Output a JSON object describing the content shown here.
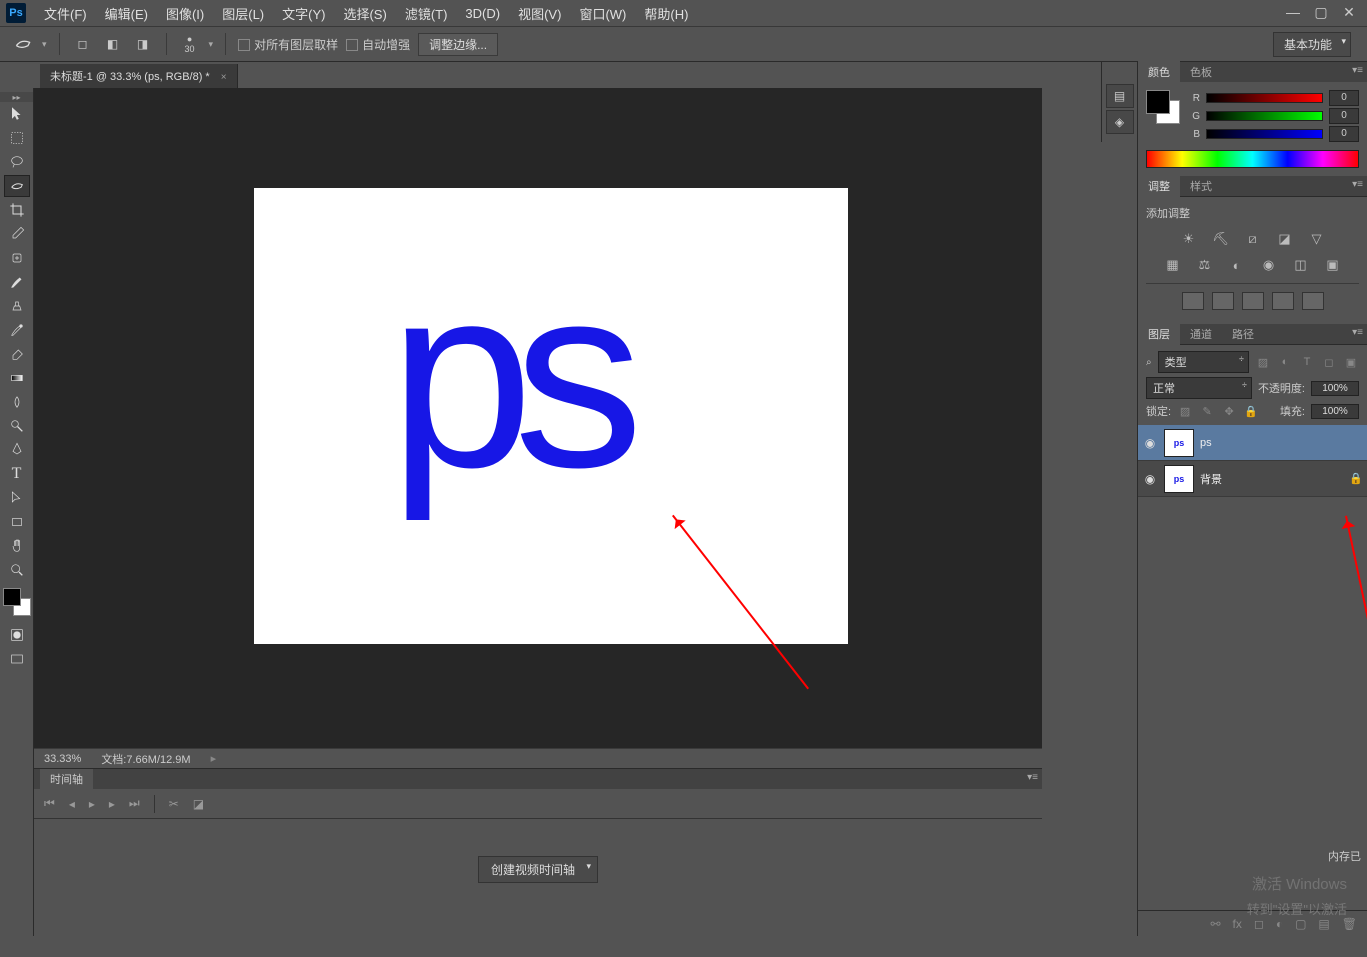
{
  "app": {
    "logo": "Ps"
  },
  "menu": [
    "文件(F)",
    "编辑(E)",
    "图像(I)",
    "图层(L)",
    "文字(Y)",
    "选择(S)",
    "滤镜(T)",
    "3D(D)",
    "视图(V)",
    "窗口(W)",
    "帮助(H)"
  ],
  "options": {
    "brush_size": "30",
    "sample_all": "对所有图层取样",
    "auto_enhance": "自动增强",
    "refine_edge": "调整边缘..."
  },
  "workspace": "基本功能",
  "doc_tab": "未标题-1 @ 33.3% (ps, RGB/8) *",
  "canvas_text": "ps",
  "status": {
    "zoom": "33.33%",
    "doc_info": "文档:7.66M/12.9M"
  },
  "timeline": {
    "tab": "时间轴",
    "create_btn": "创建视频时间轴"
  },
  "color": {
    "tabs": [
      "颜色",
      "色板"
    ],
    "r_label": "R",
    "g_label": "G",
    "b_label": "B",
    "r": "0",
    "g": "0",
    "b": "0"
  },
  "adjustments": {
    "tabs": [
      "调整",
      "样式"
    ],
    "title": "添加调整"
  },
  "layers": {
    "tabs": [
      "图层",
      "通道",
      "路径"
    ],
    "filter_label": "类型",
    "blend_mode": "正常",
    "opacity_label": "不透明度:",
    "opacity": "100%",
    "lock_label": "锁定:",
    "fill_label": "填充:",
    "fill": "100%",
    "items": [
      {
        "name": "ps",
        "thumb_text": "ps",
        "selected": true,
        "locked": false
      },
      {
        "name": "背景",
        "thumb_text": "ps",
        "selected": false,
        "locked": true
      }
    ]
  },
  "unsaved_label": "内存已",
  "watermark": {
    "line1": "激活 Windows",
    "line2": "转到\"设置\"以激活"
  }
}
